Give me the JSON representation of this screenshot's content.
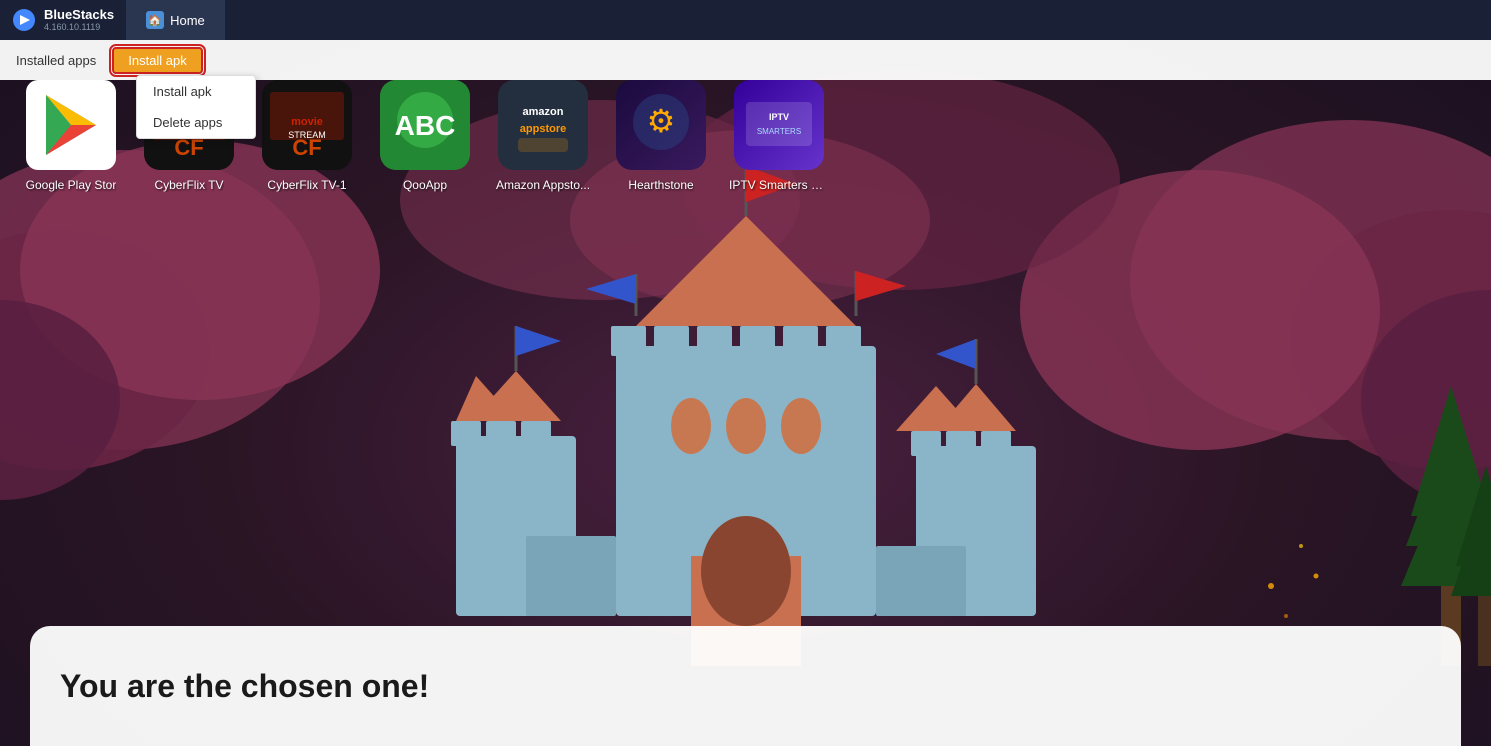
{
  "titlebar": {
    "brand_name": "BlueStacks",
    "brand_version": "4.160.10.1119",
    "tab_label": "Home"
  },
  "toolbar": {
    "installed_apps_label": "Installed apps",
    "install_apk_label": "Install apk",
    "delete_apps_label": "Delete apps"
  },
  "apps": [
    {
      "id": "google-play-store",
      "label": "Google Play Stor",
      "icon_type": "play-store"
    },
    {
      "id": "cyberflix-tv",
      "label": "CyberFlix TV",
      "icon_type": "cyberflix"
    },
    {
      "id": "cyberflix-tv-1",
      "label": "CyberFlix TV-1",
      "icon_type": "cyberflix1"
    },
    {
      "id": "qooapp",
      "label": "QooApp",
      "icon_type": "qooapp"
    },
    {
      "id": "amazon-appstore",
      "label": "Amazon Appsto...",
      "icon_type": "amazon"
    },
    {
      "id": "hearthstone",
      "label": "Hearthstone",
      "icon_type": "hearthstone"
    },
    {
      "id": "iptv-smarters",
      "label": "IPTV Smarters Pr...",
      "icon_type": "iptv"
    }
  ],
  "bottom_card": {
    "text": "You are the chosen one!"
  },
  "colors": {
    "bg_dark": "#2a1525",
    "cloud": "#7a3550",
    "castle_main": "#8ab5c8",
    "castle_roof": "#c87050",
    "accent_red": "#cc2222",
    "accent_orange": "#f0a020"
  }
}
